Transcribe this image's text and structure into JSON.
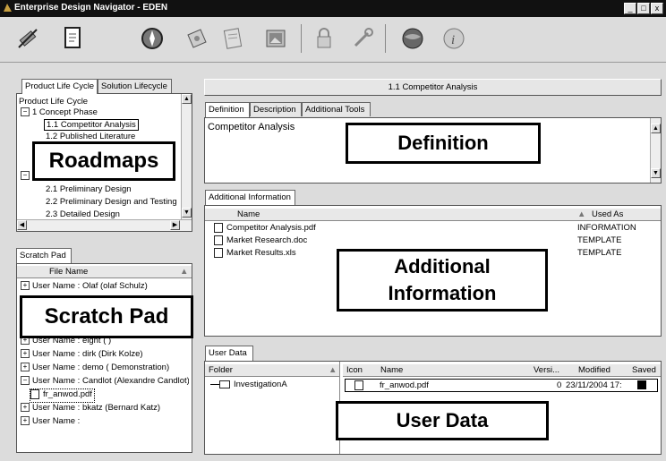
{
  "window": {
    "title": "Enterprise Design Navigator - EDEN",
    "min": "_",
    "max": "□",
    "close": "x"
  },
  "toolbar": {
    "icons": [
      "satellite-icon",
      "document-icon",
      "globe-icon",
      "page-icon",
      "notepad-icon",
      "picture-icon",
      "lock-icon",
      "wrench-icon",
      "earth-icon",
      "info-icon"
    ]
  },
  "left": {
    "tabs": [
      "Product Life Cycle",
      "Solution Lifecycle"
    ],
    "tree": [
      "Product Life Cycle",
      "1 Concept Phase",
      "1.1 Competitor Analysis",
      "1.2 Published Literature",
      "2.1 Preliminary Design",
      "2.2 Preliminary Design and Testing",
      "2.3 Detailed Design"
    ],
    "roadmaps_label": "Roadmaps"
  },
  "scratch": {
    "tab": "Scratch Pad",
    "column": "File Name",
    "rows": [
      "User Name : Olaf (olaf Schulz)",
      "User Name : eight ( )",
      "User Name : dirk (Dirk Kolze)",
      "User Name : demo ( Demonstration)",
      "User Name : Candlot (Alexandre Candlot)",
      "fr_anwod.pdf",
      "User Name : bkatz (Bernard Katz)",
      "User Name :"
    ],
    "label": "Scratch Pad"
  },
  "header": {
    "title": "1.1 Competitor Analysis"
  },
  "definition": {
    "tabs": [
      "Definition",
      "Description",
      "Additional Tools"
    ],
    "text": "Competitor Analysis",
    "label": "Definition"
  },
  "additional": {
    "tab": "Additional Information",
    "columns": [
      "Name",
      "Used As"
    ],
    "rows": [
      {
        "name": "Competitor Analysis.pdf",
        "used_as": "INFORMATION"
      },
      {
        "name": "Market Research.doc",
        "used_as": "TEMPLATE"
      },
      {
        "name": "Market Results.xls",
        "used_as": "TEMPLATE"
      }
    ],
    "label": "Additional Information"
  },
  "userdata": {
    "tab": "User Data",
    "folder_col": "Folder",
    "folder": "InvestigationA",
    "columns": [
      "Icon",
      "Name",
      "Versi...",
      "Modified",
      "Saved"
    ],
    "row": {
      "name": "fr_anwod.pdf",
      "version": "0",
      "modified": "23/11/2004 17:"
    },
    "label": "User Data"
  }
}
